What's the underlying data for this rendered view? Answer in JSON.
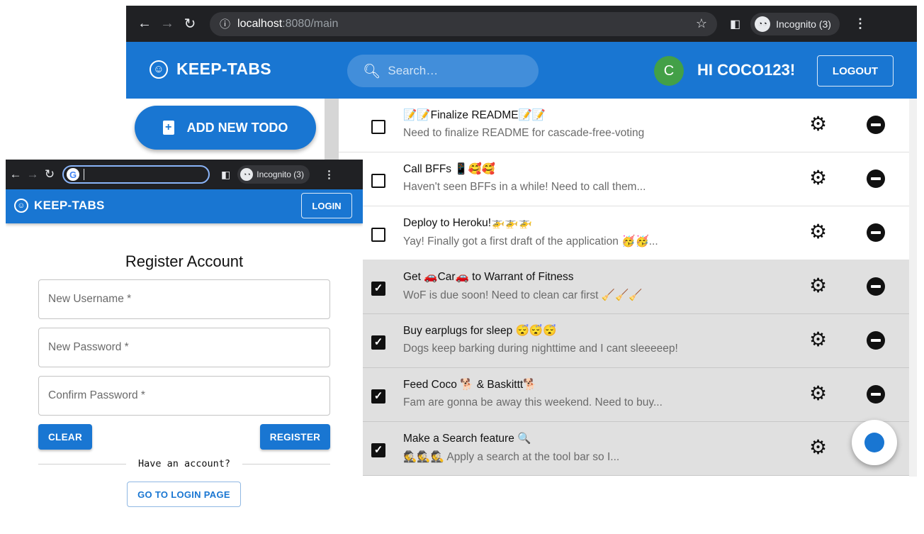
{
  "main_window": {
    "browser": {
      "url_host": "localhost",
      "url_rest": ":8080/main",
      "incognito_label": "Incognito (3)"
    },
    "appbar": {
      "brand": "KEEP-TABS",
      "search_placeholder": "Search…",
      "avatar_letter": "C",
      "greeting": "HI COCO123!",
      "logout_label": "LOGOUT",
      "color": "#1976d2"
    },
    "sidebar": {
      "add_todo_label": "ADD NEW TODO"
    },
    "todos": [
      {
        "title": "📝📝Finalize README📝📝",
        "description": "Need to finalize README for cascade-free-voting",
        "completed": false
      },
      {
        "title": "Call BFFs 📱🥰🥰",
        "description": "Haven't seen BFFs in a while! Need to call them...",
        "completed": false
      },
      {
        "title": "Deploy to Heroku!🚁🚁🚁",
        "description": "Yay! Finally got a first draft of the application 🥳🥳...",
        "completed": false
      },
      {
        "title": "Get 🚗Car🚗 to Warrant of Fitness",
        "description": "WoF is due soon! Need to clean car first 🧹🧹🧹",
        "completed": true
      },
      {
        "title": "Buy earplugs for sleep 😴😴😴",
        "description": "Dogs keep barking during nighttime and I cant sleeeeep!",
        "completed": true
      },
      {
        "title": "Feed Coco 🐕 & Baskittt🐕",
        "description": "Fam are gonna be away this weekend. Need to buy...",
        "completed": true
      },
      {
        "title": "Make a Search feature 🔍",
        "description": "🕵🕵🕵 Apply a search at the tool bar so I...",
        "completed": true
      }
    ]
  },
  "login_window": {
    "browser": {
      "incognito_label": "Incognito (3)"
    },
    "appbar": {
      "brand": "KEEP-TABS",
      "login_label": "LOGIN"
    },
    "form": {
      "title": "Register Account",
      "username_label": "New Username *",
      "password_label": "New Password *",
      "confirm_label": "Confirm Password *",
      "clear_label": "CLEAR",
      "register_label": "REGISTER",
      "have_account_text": "Have an account?",
      "goto_login_label": "GO TO LOGIN PAGE"
    }
  }
}
